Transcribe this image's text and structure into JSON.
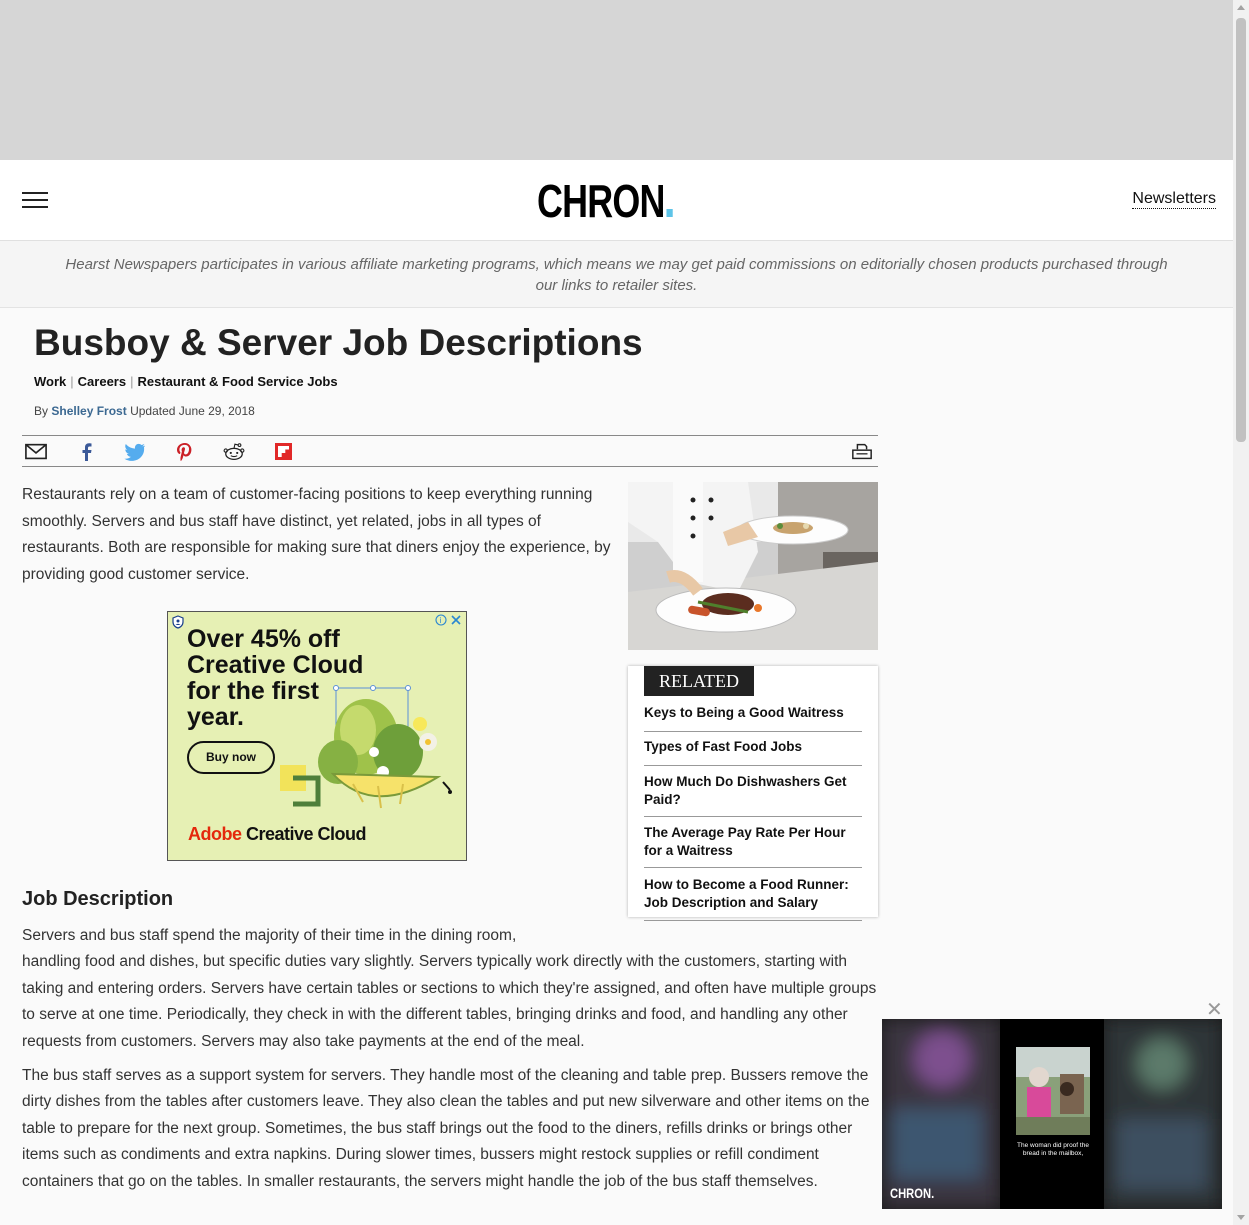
{
  "header": {
    "logo": "CHRON",
    "newsletters": "Newsletters"
  },
  "disclaimer": "Hearst Newspapers participates in various affiliate marketing programs, which means we may get paid commissions on editorially chosen products purchased through our links to retailer sites.",
  "article": {
    "title": "Busboy & Server Job Descriptions",
    "breadcrumbs": [
      "Work",
      "Careers",
      "Restaurant & Food Service Jobs"
    ],
    "byline_prefix": "By",
    "author": "Shelley Frost",
    "updated": "Updated June 29, 2018",
    "intro": "Restaurants rely on a team of customer-facing positions to keep everything running smoothly. Servers and bus staff have distinct, yet related, jobs in all types of restaurants. Both are responsible for making sure that diners enjoy the experience, by providing good customer service.",
    "section_heading": "Job Description",
    "para1_line1": "Servers and bus staff spend the majority of their time in the dining room,",
    "para1_rest": "handling food and dishes, but specific duties vary slightly. Servers typically work directly with the customers, starting with taking and entering orders. Servers have certain tables or sections to which they're assigned, and often have multiple groups to serve at one time. Periodically, they check in with the different tables, bringing drinks and food, and handling any other requests from customers. Servers may also take payments at the end of the meal.",
    "para2": "The bus staff serves as a support system for servers. They handle most of the cleaning and table prep. Bussers remove the dirty dishes from the tables after customers leave. They also clean the tables and put new silverware and other items on the table to prepare for the next group. Sometimes, the bus staff brings out the food to the diners, refills drinks or brings other items such as condiments and extra napkins. During slower times, bussers might restock supplies or refill condiment containers that go on the tables. In smaller restaurants, the servers might handle the job of the bus staff themselves."
  },
  "ad": {
    "headline": "Over 45% off Creative Cloud for the first year.",
    "button": "Buy now",
    "brand_adobe": "Adobe",
    "brand_product": "Creative Cloud"
  },
  "related": {
    "label": "RELATED",
    "items": [
      "Keys to Being a Good Waitress",
      "Types of Fast Food Jobs",
      "How Much Do Dishwashers Get Paid?",
      "The Average Pay Rate Per Hour for a Waitress",
      "How to Become a Food Runner: Job Description and Salary"
    ]
  },
  "video": {
    "logo": "CHRON.",
    "caption": "The woman did proof the bread in the mailbox,"
  },
  "colors": {
    "accent": "#5ec4e8",
    "author_link": "#3b6891",
    "ad_background": "#e6f0b4",
    "adobe_red": "#e4280c"
  },
  "icons": [
    "menu-icon",
    "email-icon",
    "facebook-icon",
    "twitter-icon",
    "pinterest-icon",
    "reddit-icon",
    "flipboard-icon",
    "print-icon",
    "close-icon"
  ]
}
